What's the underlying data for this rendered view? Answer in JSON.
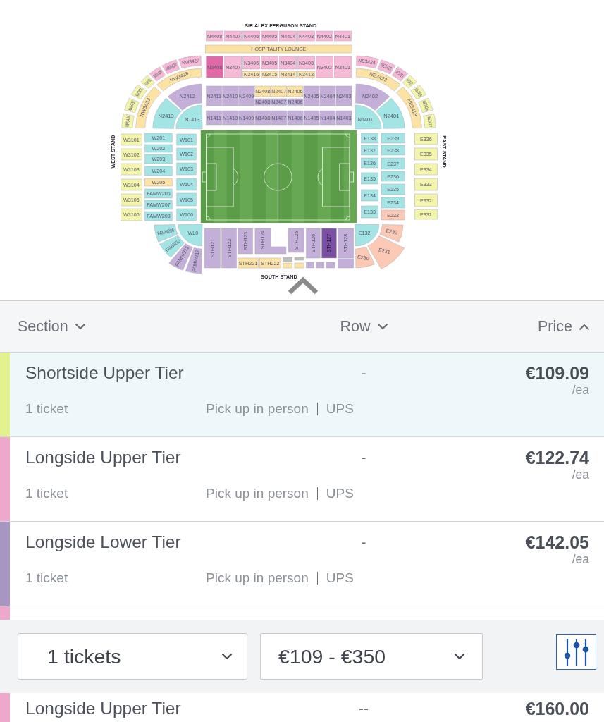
{
  "map": {
    "stand_labels": [
      "SIR ALEX FERGUSON STAND",
      "WEST STAND",
      "EAST STAND",
      "SOUTH STAND"
    ],
    "sections": [
      {
        "label": "N4408",
        "color": "#f6bad6"
      },
      {
        "label": "N4407",
        "color": "#f6bad6"
      },
      {
        "label": "N4406",
        "color": "#f6bad6"
      },
      {
        "label": "N4405",
        "color": "#f6bad6"
      },
      {
        "label": "N4404",
        "color": "#f6bad6"
      },
      {
        "label": "N4403",
        "color": "#f6bad6"
      },
      {
        "label": "N4402",
        "color": "#f6bad6"
      },
      {
        "label": "N4401",
        "color": "#f6bad6"
      },
      {
        "label": "HOSPITALITY LOUNGE",
        "color": "#fce3a4"
      },
      {
        "label": "N3408",
        "color": "#e068a6"
      },
      {
        "label": "N3407",
        "color": "#f6bad6"
      },
      {
        "label": "N3406",
        "color": "#f6bad6"
      },
      {
        "label": "N3405",
        "color": "#f6bad6"
      },
      {
        "label": "N3404",
        "color": "#f6bad6"
      },
      {
        "label": "N3403",
        "color": "#f6bad6"
      },
      {
        "label": "N3402",
        "color": "#f6bad6"
      },
      {
        "label": "N3401",
        "color": "#f6bad6"
      },
      {
        "label": "N3416",
        "color": "#fce3a4"
      },
      {
        "label": "N3415",
        "color": "#fce3a4"
      },
      {
        "label": "N3414",
        "color": "#fce3a4"
      },
      {
        "label": "N3413",
        "color": "#fce3a4"
      },
      {
        "label": "N2411",
        "color": "#c3afd8"
      },
      {
        "label": "N2410",
        "color": "#c3afd8"
      },
      {
        "label": "N2409",
        "color": "#c3afd8"
      },
      {
        "label": "N2408",
        "color": "#fce3a4"
      },
      {
        "label": "N2407",
        "color": "#fce3a4"
      },
      {
        "label": "N2406",
        "color": "#fce3a4"
      },
      {
        "label": "N2408",
        "color": "#c3afd8"
      },
      {
        "label": "N2407",
        "color": "#c3afd8"
      },
      {
        "label": "N2406",
        "color": "#c3afd8"
      },
      {
        "label": "N2405",
        "color": "#c3afd8"
      },
      {
        "label": "N2404",
        "color": "#c3afd8"
      },
      {
        "label": "N2403",
        "color": "#c3afd8"
      },
      {
        "label": "N1411",
        "color": "#c3afd8"
      },
      {
        "label": "N1410",
        "color": "#c3afd8"
      },
      {
        "label": "N1409",
        "color": "#c3afd8"
      },
      {
        "label": "N1408",
        "color": "#c3afd8"
      },
      {
        "label": "N1407",
        "color": "#c3afd8"
      },
      {
        "label": "N1406",
        "color": "#c3afd8"
      },
      {
        "label": "N1405",
        "color": "#c3afd8"
      },
      {
        "label": "N1404",
        "color": "#c3afd8"
      },
      {
        "label": "N1403",
        "color": "#c3afd8"
      },
      {
        "label": "NW3427",
        "color": "#f6bad6"
      },
      {
        "label": "NW3429",
        "color": "#f6bad6"
      },
      {
        "label": "NW3426",
        "color": "#f6bad6"
      },
      {
        "label": "NW3430",
        "color": "#f3f5aa"
      },
      {
        "label": "NW3431",
        "color": "#f3f5aa"
      },
      {
        "label": "NW3432",
        "color": "#f3f5aa"
      },
      {
        "label": "NW3434",
        "color": "#f3f5aa"
      },
      {
        "label": "NW3428",
        "color": "#fce3a4"
      },
      {
        "label": "NW3433",
        "color": "#fce3a4"
      },
      {
        "label": "N2412",
        "color": "#c3afd8"
      },
      {
        "label": "N2413",
        "color": "#a3e5e4"
      },
      {
        "label": "N1413",
        "color": "#a3e5e4"
      },
      {
        "label": "NE3424",
        "color": "#f6bad6"
      },
      {
        "label": "NE3422",
        "color": "#f6bad6"
      },
      {
        "label": "NE3421",
        "color": "#f6bad6"
      },
      {
        "label": "NE3420",
        "color": "#f3f5aa"
      },
      {
        "label": "NE3419",
        "color": "#f3f5aa"
      },
      {
        "label": "NE3416",
        "color": "#f3f5aa"
      },
      {
        "label": "NE3417",
        "color": "#f3f5aa"
      },
      {
        "label": "NE3423",
        "color": "#fce3a4"
      },
      {
        "label": "NE3418",
        "color": "#fce3a4"
      },
      {
        "label": "N2402",
        "color": "#c3afd8"
      },
      {
        "label": "N2401",
        "color": "#a3e5e4"
      },
      {
        "label": "N1401",
        "color": "#a3e5e4"
      },
      {
        "label": "W3101",
        "color": "#f3f5aa"
      },
      {
        "label": "W3102",
        "color": "#f3f5aa"
      },
      {
        "label": "W3103",
        "color": "#f3f5aa"
      },
      {
        "label": "W3104",
        "color": "#f3f5aa"
      },
      {
        "label": "W3105",
        "color": "#f3f5aa"
      },
      {
        "label": "W3106",
        "color": "#f3f5aa"
      },
      {
        "label": "W201",
        "color": "#a3e5e4"
      },
      {
        "label": "W202",
        "color": "#a3e5e4"
      },
      {
        "label": "W203",
        "color": "#a3e5e4"
      },
      {
        "label": "W204",
        "color": "#a3e5e4"
      },
      {
        "label": "W205",
        "color": "#fce3a4"
      },
      {
        "label": "FAMW206",
        "color": "#a3e5e4"
      },
      {
        "label": "FAMW207",
        "color": "#a3e5e4"
      },
      {
        "label": "FAMW208",
        "color": "#a3e5e4"
      },
      {
        "label": "W101",
        "color": "#a3e5e4"
      },
      {
        "label": "W102",
        "color": "#a3e5e4"
      },
      {
        "label": "W103",
        "color": "#a3e5e4"
      },
      {
        "label": "W104",
        "color": "#a3e5e4"
      },
      {
        "label": "W105",
        "color": "#a3e5e4"
      },
      {
        "label": "W106",
        "color": "#a3e5e4"
      },
      {
        "label": "E138",
        "color": "#a3e5e4"
      },
      {
        "label": "E137",
        "color": "#a3e5e4"
      },
      {
        "label": "E136",
        "color": "#a3e5e4"
      },
      {
        "label": "E135",
        "color": "#a3e5e4"
      },
      {
        "label": "E134",
        "color": "#a3e5e4"
      },
      {
        "label": "E133",
        "color": "#a3e5e4"
      },
      {
        "label": "E239",
        "color": "#a3e5e4"
      },
      {
        "label": "E238",
        "color": "#a3e5e4"
      },
      {
        "label": "E237",
        "color": "#a3e5e4"
      },
      {
        "label": "E236",
        "color": "#a3e5e4"
      },
      {
        "label": "E235",
        "color": "#a3e5e4"
      },
      {
        "label": "E234",
        "color": "#a3e5e4"
      },
      {
        "label": "E233",
        "color": "#fbc9b4"
      },
      {
        "label": "E336",
        "color": "#f3f5aa"
      },
      {
        "label": "E335",
        "color": "#f3f5aa"
      },
      {
        "label": "E334",
        "color": "#f3f5aa"
      },
      {
        "label": "E333",
        "color": "#f3f5aa"
      },
      {
        "label": "E332",
        "color": "#f3f5aa"
      },
      {
        "label": "E331",
        "color": "#f3f5aa"
      },
      {
        "label": "WL0",
        "color": "#a3e5e4"
      },
      {
        "label": "FAMW209",
        "color": "#a3e5e4"
      },
      {
        "label": "FAMW210",
        "color": "#a3e5e4"
      },
      {
        "label": "FAMW211",
        "color": "#c3afd8"
      },
      {
        "label": "FAMW212",
        "color": "#c3afd8"
      },
      {
        "label": "STH121",
        "color": "#c3afd8"
      },
      {
        "label": "STH122",
        "color": "#c3afd8"
      },
      {
        "label": "STH123",
        "color": "#c3afd8"
      },
      {
        "label": "STH124",
        "color": "#c3afd8"
      },
      {
        "label": "STH125",
        "color": "#c3afd8"
      },
      {
        "label": "STH126",
        "color": "#c3afd8"
      },
      {
        "label": "STH127",
        "color": "#7b50a3"
      },
      {
        "label": "STH128",
        "color": "#c3afd8"
      },
      {
        "label": "STH221",
        "color": "#fce3a4"
      },
      {
        "label": "STH222",
        "color": "#fce3a4"
      },
      {
        "color": "#bdbdbd"
      },
      {
        "color": "#fce3a4"
      },
      {
        "color": "#bdbdbd"
      },
      {
        "color": "#fce3a4"
      },
      {
        "color": "#c3afd8"
      },
      {
        "color": "#c3afd8"
      },
      {
        "color": "#c3afd8"
      },
      {
        "color": "#c3afd8"
      },
      {
        "label": "E132",
        "color": "#a3e5e4"
      },
      {
        "label": "E232",
        "color": "#fbc9b4"
      },
      {
        "label": "E231",
        "color": "#fbc9b4"
      },
      {
        "label": "E230",
        "color": "#fbc9b4"
      }
    ]
  },
  "columns": [
    {
      "label": "Section",
      "ascending": false
    },
    {
      "label": "Row",
      "ascending": false
    },
    {
      "label": "Price",
      "ascending": true
    }
  ],
  "listings": [
    {
      "section": "Shortside Upper Tier",
      "row": "-",
      "price": "€109.09",
      "unit": "/ea",
      "tickets": "1 ticket",
      "delivery": [
        "Pick up in person",
        "UPS"
      ],
      "color": "#e4f18f",
      "selected": true
    },
    {
      "section": "Longside Upper Tier",
      "row": "-",
      "price": "€122.74",
      "unit": "/ea",
      "tickets": "1 ticket",
      "delivery": [
        "Pick up in person",
        "UPS"
      ],
      "color": "#eda8cb",
      "selected": false
    },
    {
      "section": "Longside Lower Tier",
      "row": "-",
      "price": "€142.05",
      "unit": "/ea",
      "tickets": "1 ticket",
      "delivery": [
        "Pick up in person",
        "UPS"
      ],
      "color": "#a796c2",
      "selected": false
    },
    {
      "color": "#eda8cb",
      "selected": false
    }
  ],
  "filters": [
    {
      "value": "1 tickets"
    },
    {
      "value": "€109 - €350"
    }
  ],
  "pinned_listing": {
    "section": "Longside Upper Tier",
    "row": "--",
    "price": "€160.00",
    "color": "#eda8cb",
    "selected": false
  }
}
